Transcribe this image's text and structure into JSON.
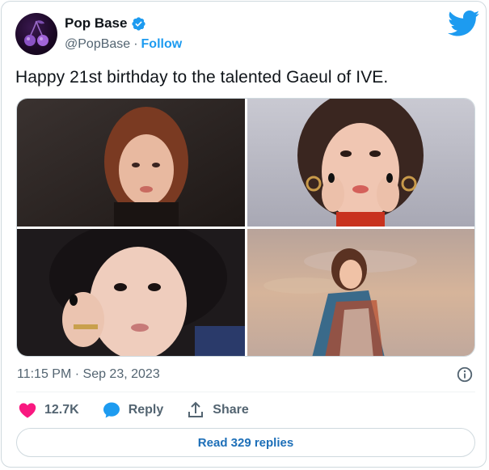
{
  "author": {
    "display_name": "Pop Base",
    "handle": "@PopBase",
    "separator": "·",
    "follow_label": "Follow",
    "verified": true
  },
  "tweet": {
    "text": "Happy 21st birthday to the talented Gaeul of IVE.",
    "timestamp": "11:15 PM · Sep 23, 2023"
  },
  "media": {
    "photos": [
      {
        "name": "photo-1",
        "alt_icon": "photo"
      },
      {
        "name": "photo-2",
        "alt_icon": "photo"
      },
      {
        "name": "photo-3",
        "alt_icon": "photo"
      },
      {
        "name": "photo-4",
        "alt_icon": "photo"
      }
    ]
  },
  "actions": {
    "like_count": "12.7K",
    "reply_label": "Reply",
    "share_label": "Share"
  },
  "read_replies_label": "Read 329 replies",
  "colors": {
    "accent": "#1d9bf0",
    "like": "#f91880",
    "text": "#0f1419",
    "muted": "#536471",
    "border": "#cfd9de"
  },
  "icons": {
    "logo": "twitter-bird-icon",
    "verified": "verified-badge-icon",
    "info": "info-icon",
    "like": "heart-icon",
    "reply": "speech-bubble-icon",
    "share": "share-upload-icon"
  }
}
